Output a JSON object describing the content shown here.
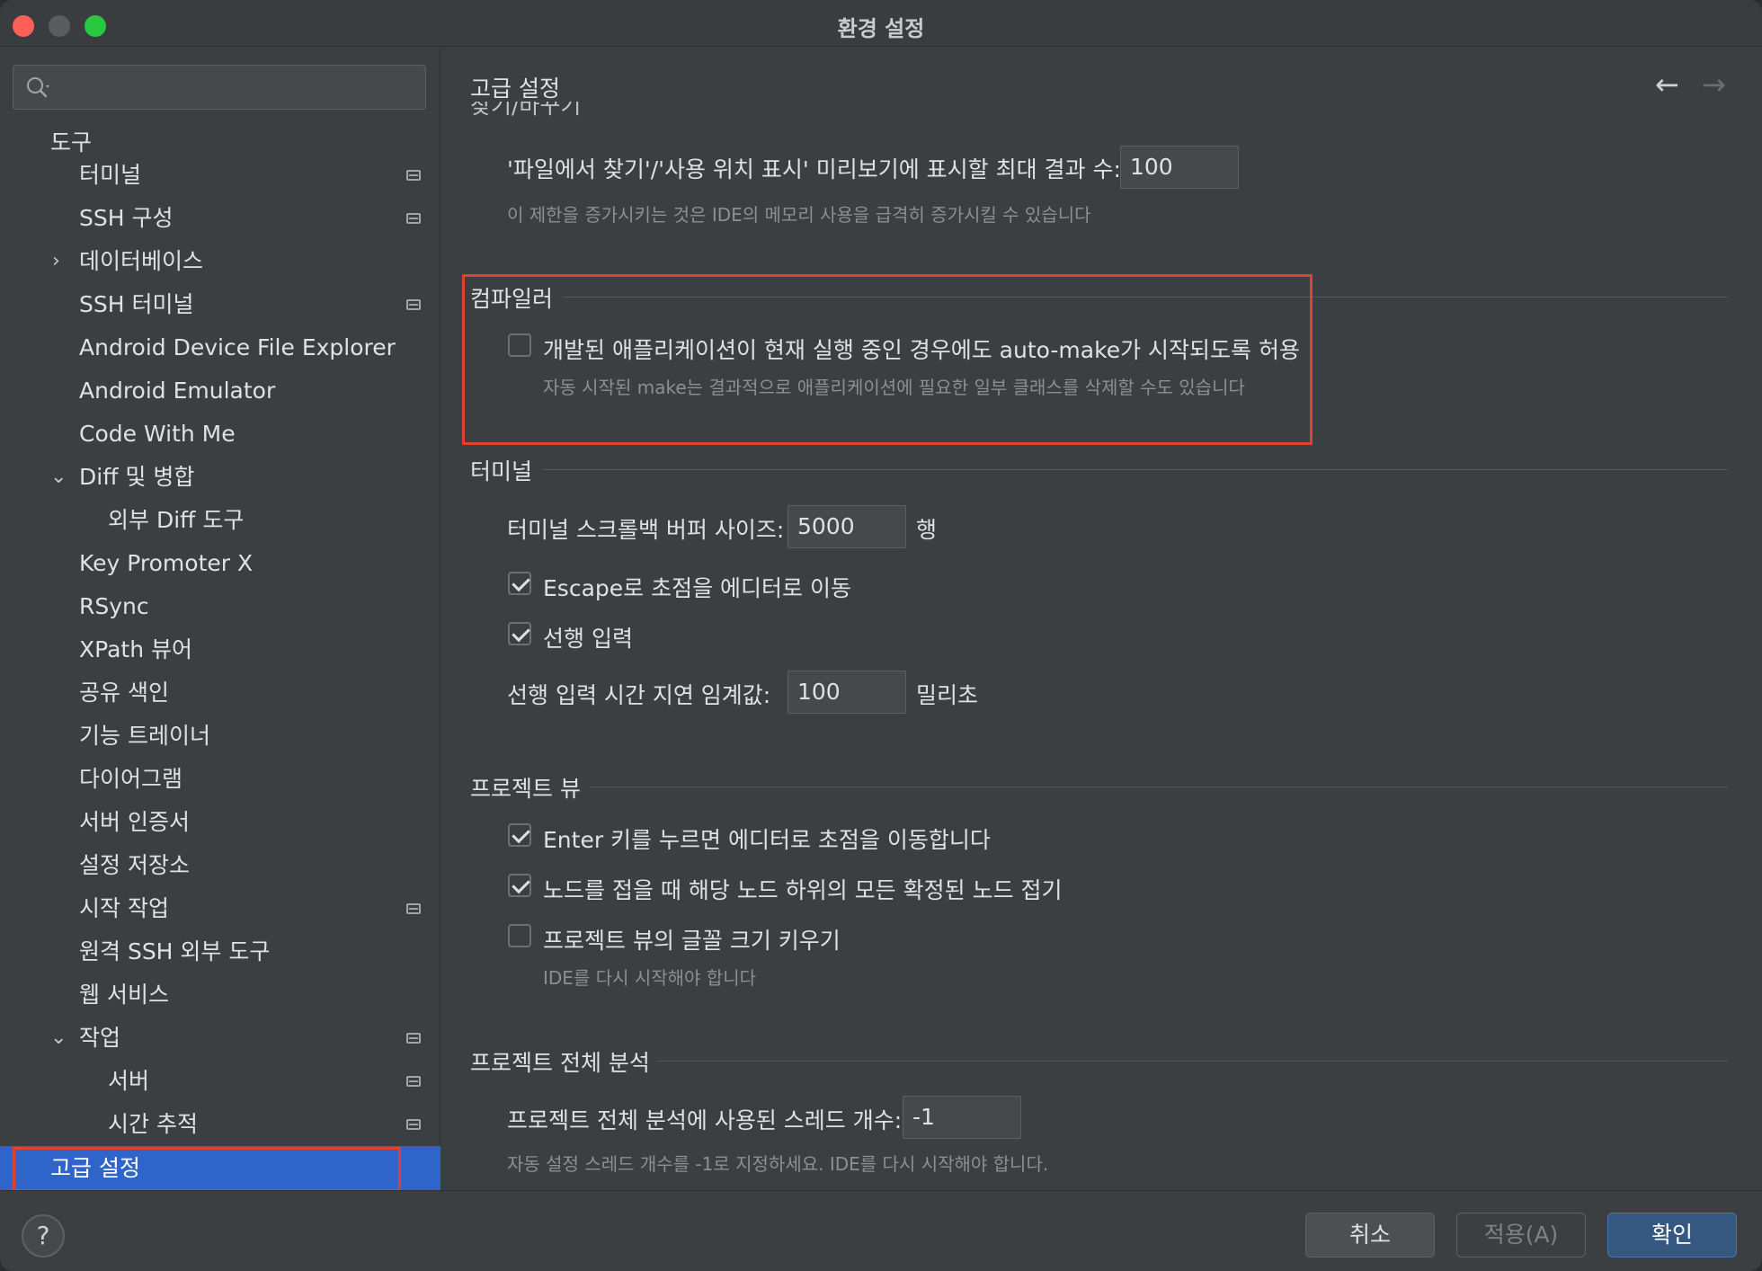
{
  "window": {
    "title": "환경 설정"
  },
  "search": {
    "placeholder": ""
  },
  "sidebar": {
    "items": [
      {
        "label": "도구"
      },
      {
        "label": "터미널"
      },
      {
        "label": "SSH 구성"
      },
      {
        "label": "데이터베이스"
      },
      {
        "label": "SSH 터미널"
      },
      {
        "label": "Android Device File Explorer"
      },
      {
        "label": "Android Emulator"
      },
      {
        "label": "Code With Me"
      },
      {
        "label": "Diff 및 병합"
      },
      {
        "label": "외부 Diff 도구"
      },
      {
        "label": "Key Promoter X"
      },
      {
        "label": "RSync"
      },
      {
        "label": "XPath 뷰어"
      },
      {
        "label": "공유 색인"
      },
      {
        "label": "기능 트레이너"
      },
      {
        "label": "다이어그램"
      },
      {
        "label": "서버 인증서"
      },
      {
        "label": "설정 저장소"
      },
      {
        "label": "시작 작업"
      },
      {
        "label": "원격 SSH 외부 도구"
      },
      {
        "label": "웹 서비스"
      },
      {
        "label": "작업"
      },
      {
        "label": "서버"
      },
      {
        "label": "시간 추적"
      },
      {
        "label": "고급 설정"
      }
    ]
  },
  "main": {
    "title": "고급 설정",
    "cut_heading": "찾기/바꾸기",
    "find": {
      "label": "'파일에서 찾기'/'사용 위치 표시' 미리보기에 표시할 최대 결과 수:",
      "value": "100",
      "hint": "이 제한을 증가시키는 것은 IDE의 메모리 사용을 급격히 증가시킬 수 있습니다"
    },
    "compiler": {
      "heading": "컴파일러",
      "auto_make_label": "개발된 애플리케이션이 현재 실행 중인 경우에도 auto-make가 시작되도록 허용",
      "auto_make_checked": false,
      "auto_make_hint": "자동 시작된 make는 결과적으로 애플리케이션에 필요한 일부 클래스를 삭제할 수도 있습니다"
    },
    "terminal": {
      "heading": "터미널",
      "buffer_label": "터미널 스크롤백 버퍼 사이즈:",
      "buffer_value": "5000",
      "buffer_unit": "행",
      "escape_label": "Escape로 초점을 에디터로 이동",
      "escape_checked": true,
      "typeahead_label": "선행 입력",
      "typeahead_checked": true,
      "delay_label": "선행 입력 시간 지연 임계값:",
      "delay_value": "100",
      "delay_unit": "밀리초"
    },
    "project_view": {
      "heading": "프로젝트 뷰",
      "enter_label": "Enter 키를 누르면 에디터로 초점을 이동합니다",
      "enter_checked": true,
      "collapse_label": "노드를 접을 때 해당 노드 하위의 모든 확정된 노드 접기",
      "collapse_checked": true,
      "font_label": "프로젝트 뷰의 글꼴 크기 키우기",
      "font_checked": false,
      "font_hint": "IDE를 다시 시작해야 합니다"
    },
    "analysis": {
      "heading": "프로젝트 전체 분석",
      "threads_label": "프로젝트 전체 분석에 사용된 스레드 개수:",
      "threads_value": "-1",
      "threads_hint": "자동 설정 스레드 개수를 -1로 지정하세요. IDE를 다시 시작해야 합니다."
    }
  },
  "footer": {
    "help_label": "?",
    "cancel_label": "취소",
    "apply_label": "적용(A)",
    "ok_label": "확인"
  },
  "colors": {
    "selection": "#2f65ca",
    "highlight_box": "#e0412e",
    "primary_button": "#365880"
  }
}
